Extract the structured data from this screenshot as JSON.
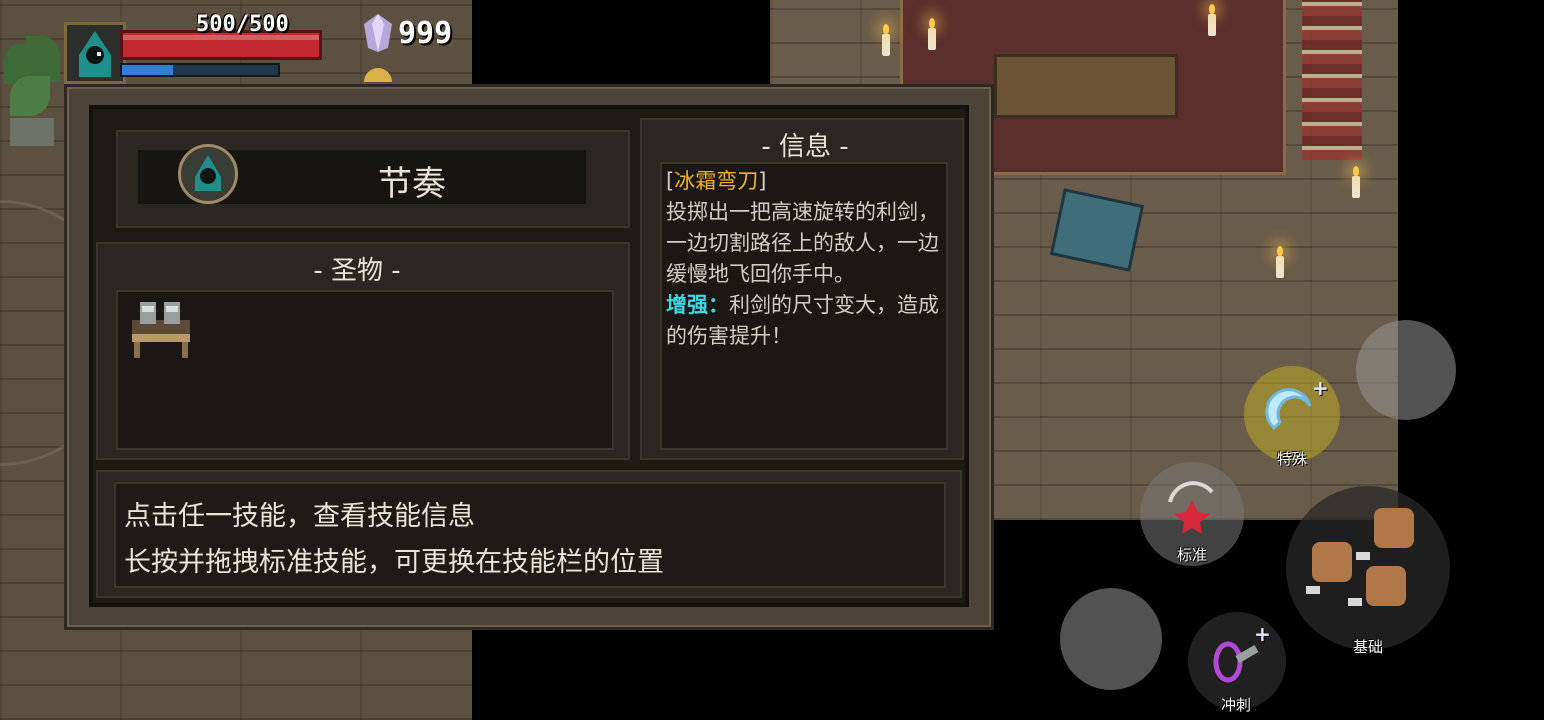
{
  "hud": {
    "hp_text": "500/500",
    "hp_fraction": 1.0,
    "mana_fraction": 0.33,
    "gem_count": "999",
    "icons": [
      "hooded-wizard-portrait-icon",
      "crystal-gem-icon",
      "gold-coin-icon"
    ]
  },
  "panel": {
    "character_name": "节奏",
    "relic_heading": "- 圣物 -",
    "info_heading": "- 信息 -",
    "info": {
      "bracket_open": "[",
      "skill_name": "冰霜弯刀",
      "bracket_close": "]",
      "description": "投掷出一把高速旋转的利剑，一边切割路径上的敌人，一边缓慢地飞回你手中。",
      "boost_label": "增强：",
      "boost_text": "利剑的尺寸变大，造成的伤害提升！"
    },
    "hint_line_1": "点击任一技能，查看技能信息",
    "hint_line_2": "长按并拖拽标准技能，可更换在技能栏的位置"
  },
  "skills": {
    "special": {
      "label": "特殊",
      "icon": "ice-crescent-blade-icon"
    },
    "standard": {
      "label": "标准",
      "icon": "red-burst-icon"
    },
    "basic": {
      "label": "基础",
      "icon": "fist-strike-icon"
    },
    "dash": {
      "label": "冲刺",
      "icon": "purple-dash-icon"
    }
  },
  "colors": {
    "skill_name": "#f2b229",
    "boost_label": "#3fd6e6",
    "hp_bar": "#c22a30",
    "mana_bar": "#2f7fd0"
  }
}
